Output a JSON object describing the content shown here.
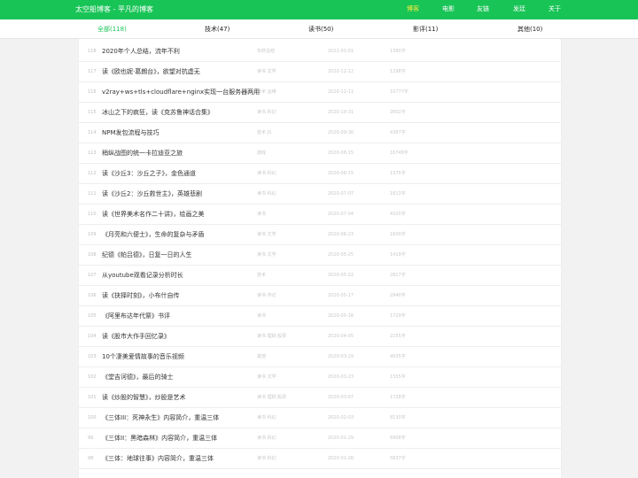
{
  "header": {
    "title": "太空船博客 - 平凡的博客",
    "nav": [
      "博客",
      "电影",
      "友链",
      "发廷",
      "关于"
    ],
    "accent_color": "#19c457",
    "active_nav_color": "#ffeb3b"
  },
  "tabs": [
    {
      "label": "全部(118)"
    },
    {
      "label": "技术(47)"
    },
    {
      "label": "读书(50)"
    },
    {
      "label": "影评(11)"
    },
    {
      "label": "其他(10)"
    }
  ],
  "posts": [
    {
      "num": "118",
      "title": "2020年个人总结，流年不利",
      "tags": "年终总结",
      "date": "2021-01-01",
      "words": "1380字"
    },
    {
      "num": "117",
      "title": "读《欧也妮·葛朗台》，欲望对抗虚无",
      "tags": "读书 文学",
      "date": "2020-12-12",
      "words": "1298字"
    },
    {
      "num": "116",
      "title": "v2ray+ws+tls+cloudflare+nginx实现一台服务器两用",
      "tags": "技术 运维",
      "date": "2020-12-11",
      "words": "10777字"
    },
    {
      "num": "115",
      "title": "冰山之下的疯狂，读《克苏鲁神话合集》",
      "tags": "读书 科幻",
      "date": "2020-10-31",
      "words": "2802字"
    },
    {
      "num": "114",
      "title": "NPM发包流程与技巧",
      "tags": "技术 JS",
      "date": "2020-09-30",
      "words": "4387字"
    },
    {
      "num": "113",
      "title": "稍纵战图的统一卡拉迪亚之旅",
      "tags": "游戏",
      "date": "2020-08-15",
      "words": "16748字"
    },
    {
      "num": "112",
      "title": "读《沙丘3：沙丘之子》，金色通道",
      "tags": "读书 科幻",
      "date": "2020-08-15",
      "words": "1375字"
    },
    {
      "num": "111",
      "title": "读《沙丘2：沙丘救世主》，英雄悲剧",
      "tags": "读书 科幻",
      "date": "2020-07-07",
      "words": "1613字"
    },
    {
      "num": "110",
      "title": "读《世界美术名作二十讲》，绘画之美",
      "tags": "读书",
      "date": "2020-07-04",
      "words": "4320字"
    },
    {
      "num": "109",
      "title": "《月亮和六便士》，生命的复杂与矛盾",
      "tags": "读书 文学",
      "date": "2020-06-23",
      "words": "1600字"
    },
    {
      "num": "108",
      "title": "纪德《帕吕德》，日复一日的人生",
      "tags": "读书 文学",
      "date": "2020-05-25",
      "words": "1419字"
    },
    {
      "num": "107",
      "title": "从youtube观看记录分析时长",
      "tags": "技术",
      "date": "2020-05-22",
      "words": "2817字"
    },
    {
      "num": "106",
      "title": "读《抉择时刻》，小布什自传",
      "tags": "读书 传记",
      "date": "2020-05-17",
      "words": "2940字"
    },
    {
      "num": "105",
      "title": "《阿里布达年代祭》书评",
      "tags": "读书",
      "date": "2020-05-16",
      "words": "1729字"
    },
    {
      "num": "104",
      "title": "读《股市大作手回忆录》",
      "tags": "读书 理财 股票",
      "date": "2020-04-05",
      "words": "2255字"
    },
    {
      "num": "103",
      "title": "10个凄美爱情故事的音乐视频",
      "tags": "其他",
      "date": "2020-03-29",
      "words": "4935字"
    },
    {
      "num": "102",
      "title": "《堂吉诃德》，最后的骑士",
      "tags": "读书 文学",
      "date": "2020-03-23",
      "words": "1555字"
    },
    {
      "num": "101",
      "title": "读《炒股的智慧》，炒股是艺术",
      "tags": "读书 理财 股票",
      "date": "2020-03-07",
      "words": "1728字"
    },
    {
      "num": "100",
      "title": "《三体III：死神永生》内容简介，重温三体",
      "tags": "读书 科幻",
      "date": "2020-02-03",
      "words": "8130字"
    },
    {
      "num": "99",
      "title": "《三体II：黑暗森林》内容简介，重温三体",
      "tags": "读书 科幻",
      "date": "2020-01-29",
      "words": "6908字"
    },
    {
      "num": "98",
      "title": "《三体：地球往事》内容简介，重温三体",
      "tags": "读书 科幻",
      "date": "2020-01-26",
      "words": "5837字"
    }
  ]
}
